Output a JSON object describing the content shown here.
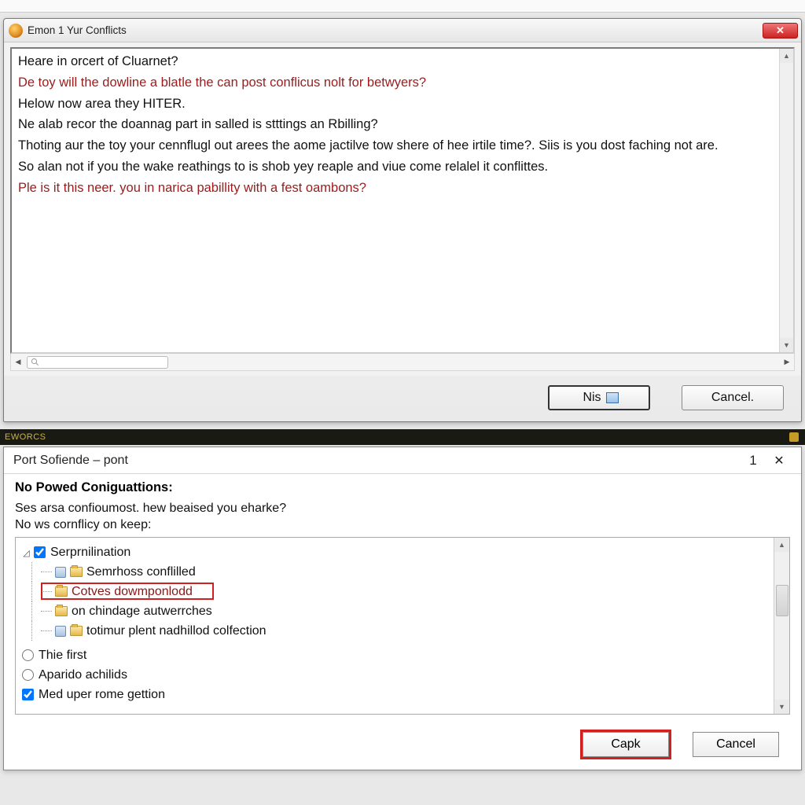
{
  "top_strip": "",
  "dialog1": {
    "title": "Emon 1 Yur Conflicts",
    "close_tooltip": "Close",
    "text": {
      "l1": "Heare in orcert of Cluarnet?",
      "l2": "De toy will the dowline a blatle the can post conflicus nolt for betwyers?",
      "l3": "Helow now area they HITER.",
      "l4": "",
      "l5": "Ne alab recor the doannag part in salled is stttings an Rbilling?",
      "l6": "Thoting aur the toy your cennflugl out arees the aome jactilve tow shere of hee irtile time?.  Siis is you dost faching not are.",
      "l7": "",
      "l8": "So alan not if you the wake reathings to is shob yey reaple and viue come relalel it conflittes.",
      "l9": "",
      "l10": "Ple is it this neer. you in narica pabillity with a fest oambons?"
    },
    "ok_label": "Nis",
    "cancel_label": "Cancel."
  },
  "dark_strip_label": "EWORCS",
  "dialog2": {
    "title": "Port Sofiende – pont",
    "count": "1",
    "heading": "No Powed Coniguattions:",
    "sub1": "Ses arsa confioumost. hew beaised you eharke?",
    "sub2": "No ws cornflicy on keep:",
    "tree": {
      "root": "Serprnilination",
      "items": [
        "Semrhoss conflilled",
        "Cotves   dowmponlodd",
        "on chindage autwerrches",
        "totimur plent nadhillod colfection"
      ]
    },
    "options": {
      "opt1": "Thie first",
      "opt2": "Aparido achilids",
      "opt3": "Med uper rome gettion"
    },
    "ok_label": "Capk",
    "cancel_label": "Cancel"
  }
}
